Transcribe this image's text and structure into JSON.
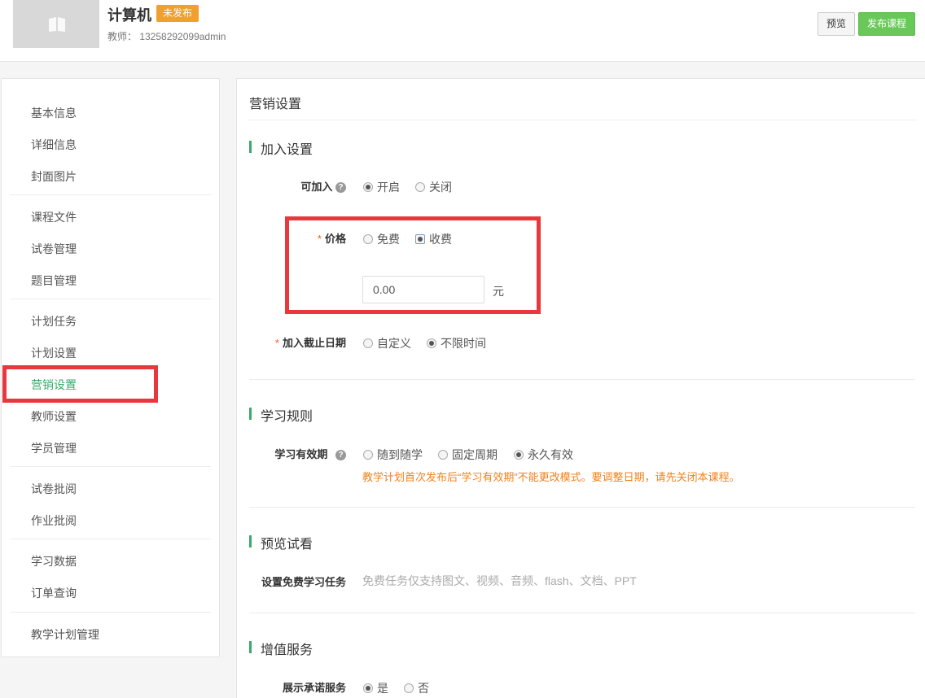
{
  "header": {
    "course_title": "计算机",
    "status_badge": "未发布",
    "teacher": "教师： 13258292099admin",
    "preview_label": "预览",
    "publish_label": "发布课程"
  },
  "sidebar": {
    "items": [
      {
        "label": "基本信息"
      },
      {
        "label": "详细信息"
      },
      {
        "label": "封面图片"
      },
      {
        "label": "课程文件"
      },
      {
        "label": "试卷管理"
      },
      {
        "label": "题目管理"
      },
      {
        "label": "计划任务"
      },
      {
        "label": "计划设置"
      },
      {
        "label": "营销设置",
        "active": true
      },
      {
        "label": "教师设置"
      },
      {
        "label": "学员管理"
      },
      {
        "label": "试卷批阅"
      },
      {
        "label": "作业批阅"
      },
      {
        "label": "学习数据"
      },
      {
        "label": "订单查询"
      },
      {
        "label": "教学计划管理"
      }
    ]
  },
  "main": {
    "page_title": "营销设置",
    "join": {
      "section_title": "加入设置",
      "joinable_label": "可加入",
      "joinable_options": [
        "开启",
        "关闭"
      ],
      "joinable_selected": "开启",
      "price_label": "价格",
      "price_options": [
        "免费",
        "收费"
      ],
      "price_selected": "收费",
      "price_value": "0.00",
      "price_unit": "元",
      "deadline_label": "加入截止日期",
      "deadline_options": [
        "自定义",
        "不限时间"
      ],
      "deadline_selected": "不限时间"
    },
    "rules": {
      "section_title": "学习规则",
      "validity_label": "学习有效期",
      "validity_options": [
        "随到随学",
        "固定周期",
        "永久有效"
      ],
      "validity_selected": "永久有效",
      "warning": "教学计划首次发布后“学习有效期”不能更改模式。要调整日期，请先关闭本课程。"
    },
    "preview": {
      "section_title": "预览试看",
      "free_task_label": "设置免费学习任务",
      "free_task_hint": "免费任务仅支持图文、视频、音频、flash、文档、PPT"
    },
    "value_added": {
      "section_title": "增值服务",
      "promise_label": "展示承诺服务",
      "promise_options": [
        "是",
        "否"
      ],
      "promise_selected": "是"
    }
  },
  "colors": {
    "accent_green": "#3aaa6b",
    "badge_orange": "#f0a030",
    "publish_green": "#6ac85a",
    "highlight_red": "#e8383d",
    "warning_orange": "#f0821e"
  }
}
